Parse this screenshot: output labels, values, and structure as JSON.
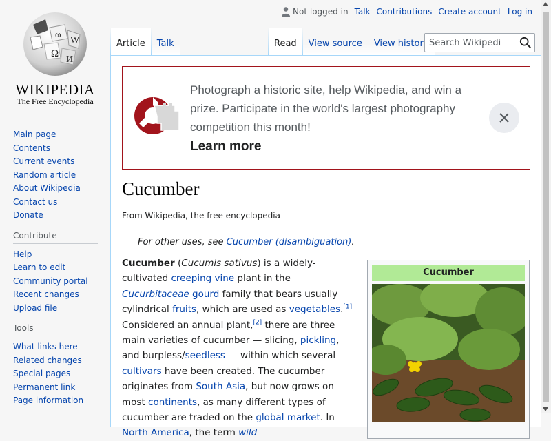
{
  "logo": {
    "wordmark": "WIKIPEDIA",
    "tagline": "The Free Encyclopedia",
    "icon": "wikipedia-globe"
  },
  "personal": {
    "not_logged_in": "Not logged in",
    "talk": "Talk",
    "contributions": "Contributions",
    "create_account": "Create account",
    "log_in": "Log in"
  },
  "nav": {
    "main": [
      "Main page",
      "Contents",
      "Current events",
      "Random article",
      "About Wikipedia",
      "Contact us",
      "Donate"
    ],
    "contribute_heading": "Contribute",
    "contribute": [
      "Help",
      "Learn to edit",
      "Community portal",
      "Recent changes",
      "Upload file"
    ],
    "tools_heading": "Tools",
    "tools": [
      "What links here",
      "Related changes",
      "Special pages",
      "Permanent link",
      "Page information"
    ]
  },
  "tabs": {
    "article": "Article",
    "talk": "Talk",
    "read": "Read",
    "view_source": "View source",
    "view_history": "View history"
  },
  "search": {
    "placeholder": "Search Wikipedia"
  },
  "banner": {
    "text": "Photograph a historic site, help Wikipedia, and win a prize. Participate in the world's largest photography competition this month!",
    "learn_more": "Learn more",
    "accent": "#a2141c"
  },
  "article": {
    "title": "Cucumber",
    "subtitle": "From Wikipedia, the free encyclopedia",
    "hatnote_prefix": "For other uses, see ",
    "hatnote_link": "Cucumber (disambiguation)",
    "hatnote_suffix": ".",
    "p": {
      "b": "Cucumber",
      "t1": " (",
      "sci": "Cucumis sativus",
      "t2": ") is a widely-cultivated ",
      "l1": "creeping vine",
      "t3": " plant in the ",
      "l2": "Cucurbitaceae",
      "t4": " ",
      "l3": "gourd",
      "t5": " family that bears usually cylindrical ",
      "l4": "fruits",
      "t6": ", which are used as ",
      "l5": "vegetables",
      "t7": ".",
      "r1": "[1]",
      "t8": " Considered an annual plant,",
      "r2": "[2]",
      "t9": " there are three main varieties of cucumber — slicing, ",
      "l6": "pickling",
      "t10": ", and burpless/",
      "l7": "seedless",
      "t11": " — within which several ",
      "l8": "cultivars",
      "t12": " have been created. The cucumber originates from ",
      "l9": "South Asia",
      "t13": ", but now grows on most ",
      "l10": "continents",
      "t14": ", as many different types of cucumber are traded on the ",
      "l11": "global market",
      "t15": ". In ",
      "l12": "North America",
      "t16": ", the term ",
      "l13": "wild"
    },
    "infobox_title": "Cucumber",
    "infobox_header_color": "#b1ea96"
  }
}
